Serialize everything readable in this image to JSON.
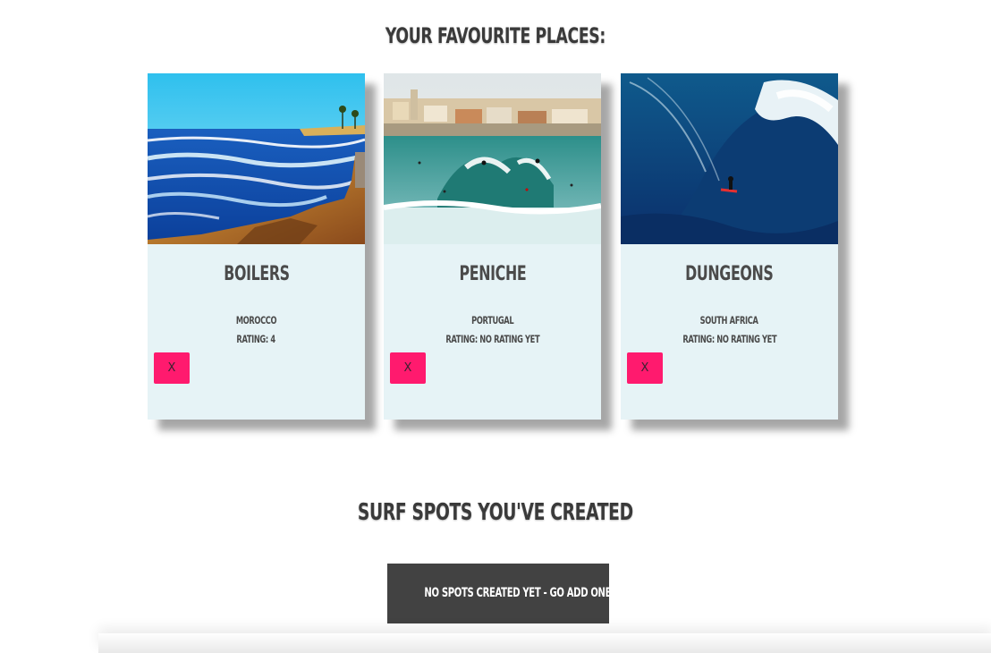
{
  "favourites": {
    "title": "Your Favourite Places:",
    "remove_label": "X",
    "cards": [
      {
        "name": "Boilers",
        "country": "Morocco",
        "rating": "Rating: 4"
      },
      {
        "name": "Peniche",
        "country": "Portugal",
        "rating": "Rating: No rating yet"
      },
      {
        "name": "Dungeons",
        "country": "South Africa",
        "rating": "Rating: No rating yet"
      }
    ]
  },
  "created": {
    "title": "Surf Spots You've Created",
    "empty_button": "No spots created yet - go add one!"
  },
  "colors": {
    "card_bg": "#e6f3f6",
    "remove_button": "#ff1a6e",
    "dark_button": "#424242",
    "heading": "#3a3a3a"
  }
}
